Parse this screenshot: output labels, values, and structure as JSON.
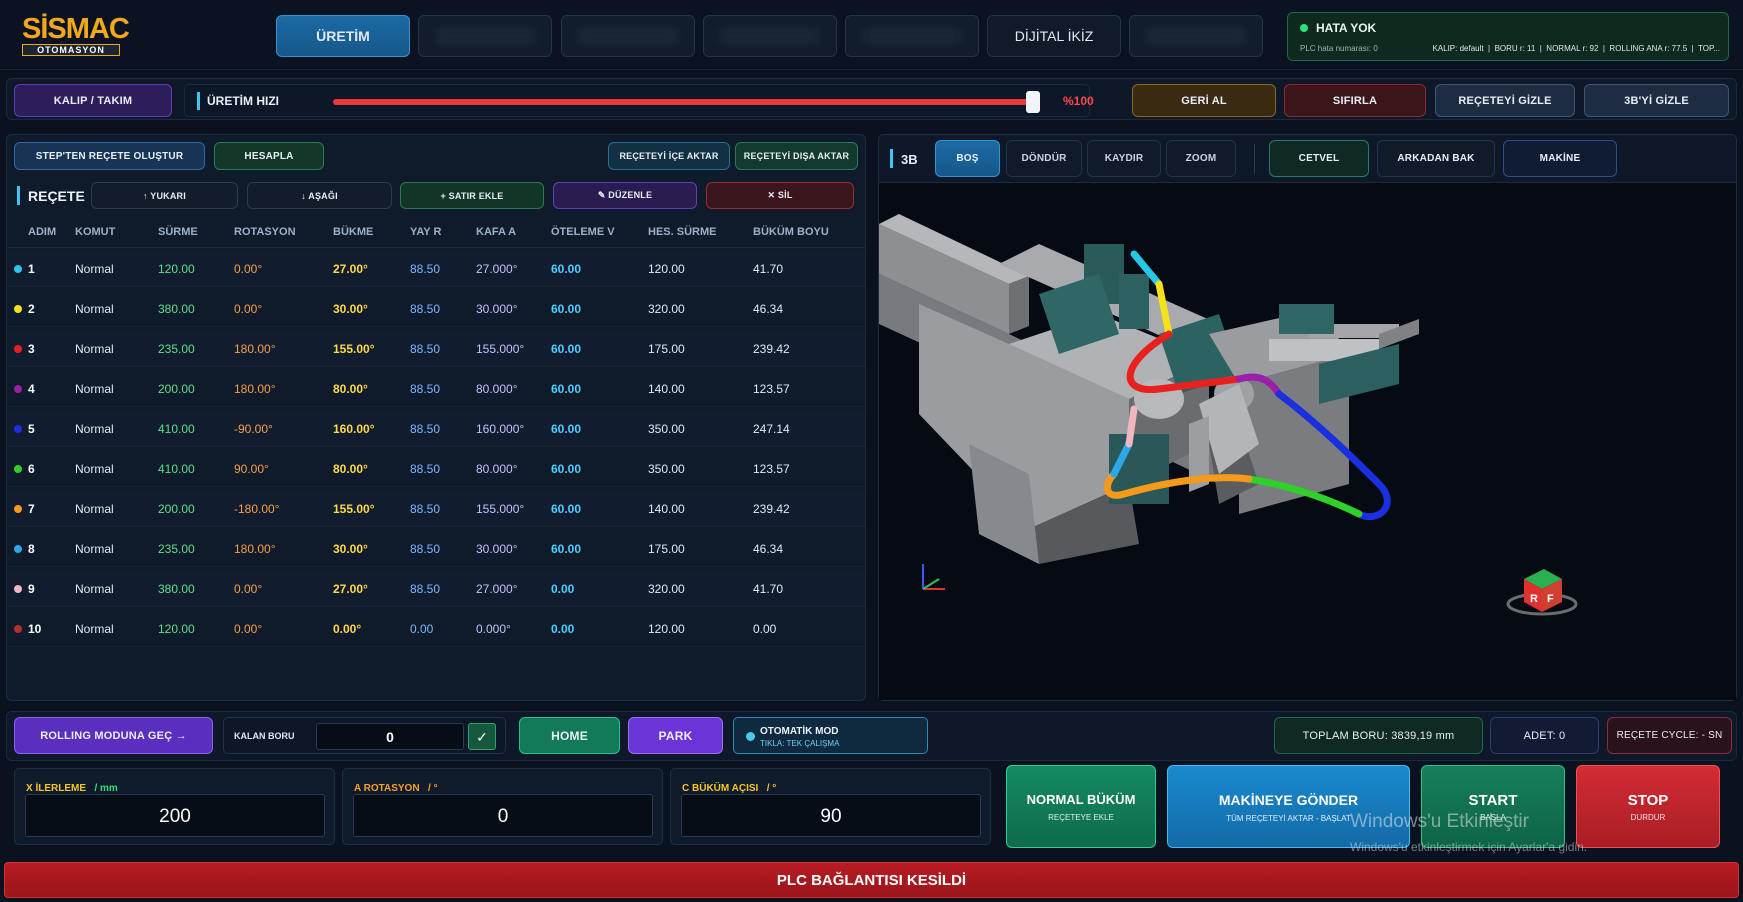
{
  "header": {
    "logo_top": "SİSMAC",
    "logo_bottom": "OTOMASYON",
    "tabs": [
      "ÜRETİM",
      "",
      "",
      "",
      "",
      "DİJİTAL İKİZ",
      ""
    ],
    "status": {
      "title": "HATA YOK",
      "plc_error": "PLC hata numarası: 0",
      "details": "KALIP: default  |  BORU r: 11  |  NORMAL r: 92  |  ROLLING ANA r: 77.5  |  TOP..."
    }
  },
  "toolbar": {
    "mold_button": "KALIP / TAKIM",
    "speed_label": "ÜRETİM HIZI",
    "speed_value": "%100",
    "speed_fraction": 1.0,
    "undo_button": "GERİ AL",
    "reset_button": "SIFIRLA",
    "hide_recipe_button": "REÇETEYİ GİZLE",
    "hide_3d_button": "3B'Yİ GİZLE"
  },
  "recipe": {
    "create_from_step": "STEP'TEN REÇETE OLUŞTUR",
    "calculate": "HESAPLA",
    "import": "REÇETEYİ İÇE AKTAR",
    "export": "REÇETEYİ DIŞA AKTAR",
    "title": "REÇETE",
    "up": "↑ YUKARI",
    "down": "↓ AŞAĞI",
    "add_row": "+ SATIR EKLE",
    "edit": "✎ DÜZENLE",
    "delete": "✕ SİL",
    "columns": [
      "ADIM",
      "KOMUT",
      "SÜRME",
      "ROTASYON",
      "BÜKME",
      "YAY R",
      "KAFA A",
      "ÖTELEME V",
      "HES. SÜRME",
      "BÜKÜM BOYU"
    ],
    "rows": [
      {
        "step": "1",
        "cmd": "Normal",
        "push": "120.00",
        "rot": "0.00°",
        "bend": "27.00°",
        "r": "88.50",
        "head": "27.000°",
        "shift": "60.00",
        "calc": "120.00",
        "len": "41.70",
        "color": "#29c6e8"
      },
      {
        "step": "2",
        "cmd": "Normal",
        "push": "380.00",
        "rot": "0.00°",
        "bend": "30.00°",
        "r": "88.50",
        "head": "30.000°",
        "shift": "60.00",
        "calc": "320.00",
        "len": "46.34",
        "color": "#f5e21a"
      },
      {
        "step": "3",
        "cmd": "Normal",
        "push": "235.00",
        "rot": "180.00°",
        "bend": "155.00°",
        "r": "88.50",
        "head": "155.000°",
        "shift": "60.00",
        "calc": "175.00",
        "len": "239.42",
        "color": "#e8211f"
      },
      {
        "step": "4",
        "cmd": "Normal",
        "push": "200.00",
        "rot": "180.00°",
        "bend": "80.00°",
        "r": "88.50",
        "head": "80.000°",
        "shift": "60.00",
        "calc": "140.00",
        "len": "123.57",
        "color": "#9b1fa8"
      },
      {
        "step": "5",
        "cmd": "Normal",
        "push": "410.00",
        "rot": "-90.00°",
        "bend": "160.00°",
        "r": "88.50",
        "head": "160.000°",
        "shift": "60.00",
        "calc": "350.00",
        "len": "247.14",
        "color": "#1a2fe0"
      },
      {
        "step": "6",
        "cmd": "Normal",
        "push": "410.00",
        "rot": "90.00°",
        "bend": "80.00°",
        "r": "88.50",
        "head": "80.000°",
        "shift": "60.00",
        "calc": "350.00",
        "len": "123.57",
        "color": "#2ed12a"
      },
      {
        "step": "7",
        "cmd": "Normal",
        "push": "200.00",
        "rot": "-180.00°",
        "bend": "155.00°",
        "r": "88.50",
        "head": "155.000°",
        "shift": "60.00",
        "calc": "140.00",
        "len": "239.42",
        "color": "#f59a1a"
      },
      {
        "step": "8",
        "cmd": "Normal",
        "push": "235.00",
        "rot": "180.00°",
        "bend": "30.00°",
        "r": "88.50",
        "head": "30.000°",
        "shift": "60.00",
        "calc": "175.00",
        "len": "46.34",
        "color": "#2aa8e8"
      },
      {
        "step": "9",
        "cmd": "Normal",
        "push": "380.00",
        "rot": "0.00°",
        "bend": "27.00°",
        "r": "88.50",
        "head": "27.000°",
        "shift": "0.00",
        "calc": "320.00",
        "len": "41.70",
        "color": "#f1b6c0"
      },
      {
        "step": "10",
        "cmd": "Normal",
        "push": "120.00",
        "rot": "0.00°",
        "bend": "0.00°",
        "r": "0.00",
        "head": "0.000°",
        "shift": "0.00",
        "calc": "120.00",
        "len": "0.00",
        "color": "#b33030"
      }
    ]
  },
  "viewer": {
    "title": "3B",
    "modes": [
      "BOŞ",
      "DÖNDÜR",
      "KAYDIR",
      "ZOOM"
    ],
    "tools": [
      "CETVEL",
      "ARKADAN BAK",
      "MAKİNE"
    ],
    "cube_faces": [
      "R",
      "F"
    ]
  },
  "bottom": {
    "rolling_button": "ROLLING MODUNA GEÇ →",
    "remaining_label": "KALAN BORU",
    "remaining_value": "0",
    "confirm": "✓",
    "home": "HOME",
    "park": "PARK",
    "auto_mode": "OTOMATİK MOD",
    "auto_sub": "TIKLA: TEK ÇALIŞMA",
    "total_pipe": "TOPLAM BORU: 3839,19 mm",
    "count": "ADET: 0",
    "cycle": "REÇETE CYCLE: - SN",
    "x_label": "X  İLERLEME",
    "x_unit": "/ mm",
    "x_value": "200",
    "a_label": "A  ROTASYON",
    "a_unit": "/ °",
    "a_value": "0",
    "c_label": "C  BÜKÜM AÇISI",
    "c_unit": "/ °",
    "c_value": "90",
    "normal_bend": "NORMAL BÜKÜM",
    "normal_bend_sub": "REÇETEYE EKLE",
    "send": "MAKİNEYE GÖNDER",
    "send_sub": "TÜM REÇETEYİ AKTAR - BAŞLAT",
    "start": "START",
    "start_sub": "BAŞLA",
    "stop": "STOP",
    "stop_sub": "DURDUR",
    "watermark_1": "Windows'u Etkinleştir",
    "watermark_2": "Windows'u etkinleştirmek için Ayarlar'a gidin.",
    "plc_banner": "PLC BAĞLANTISI KESİLDİ"
  }
}
